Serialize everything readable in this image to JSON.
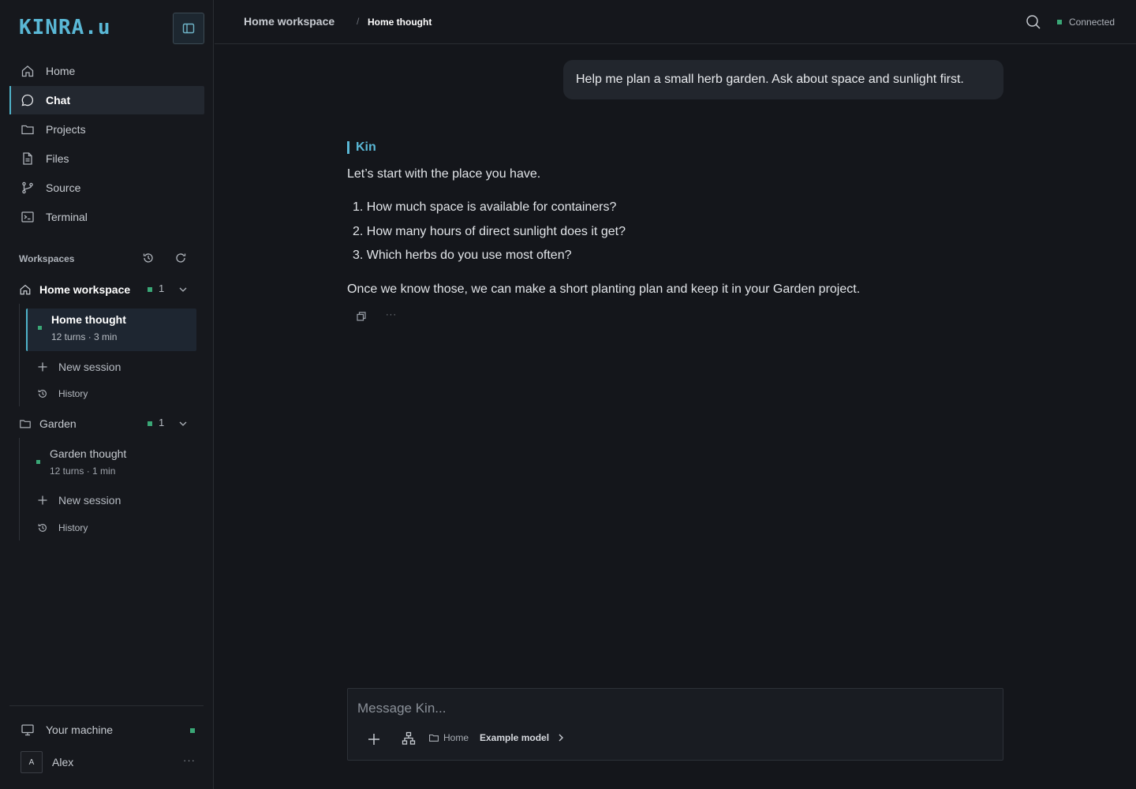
{
  "app": {
    "logo_text": "KINRA.u"
  },
  "nav": {
    "items": [
      {
        "label": "Home",
        "icon": "home-icon"
      },
      {
        "label": "Chat",
        "icon": "chat-icon",
        "active": true
      },
      {
        "label": "Projects",
        "icon": "folder-icon"
      },
      {
        "label": "Files",
        "icon": "file-icon"
      },
      {
        "label": "Source",
        "icon": "git-branch-icon"
      },
      {
        "label": "Terminal",
        "icon": "terminal-icon"
      }
    ]
  },
  "workspaces": {
    "header": "Workspaces",
    "groups": [
      {
        "name": "Home workspace",
        "count": "1",
        "sessions": [
          {
            "title": "Home thought",
            "meta": "12 turns · 3 min",
            "active": true
          }
        ],
        "new_session": "New session",
        "history": "History"
      },
      {
        "name": "Garden",
        "count": "1",
        "sessions": [
          {
            "title": "Garden thought",
            "meta": "12 turns · 1 min",
            "active": false
          }
        ],
        "new_session": "New session",
        "history": "History"
      }
    ]
  },
  "footer": {
    "machine": "Your machine",
    "user_initial": "A",
    "user_name": "Alex",
    "more": "···"
  },
  "topbar": {
    "breadcrumb_workspace": "Home workspace",
    "separator": "/",
    "breadcrumb_current": "Home thought",
    "status": "Connected"
  },
  "chat": {
    "user_message": "Help me plan a small herb garden. Ask about space and sunlight first.",
    "assistant_name": "Kin",
    "intro": "Let’s start with the place you have.",
    "questions": [
      "1. How much space is available for containers?",
      "2. How many hours of direct sunlight does it get?",
      "3. Which herbs do you use most often?"
    ],
    "closing": "Once we know those, we can make a short planting plan and keep it in your Garden project.",
    "more": "···"
  },
  "composer": {
    "placeholder": "Message Kin...",
    "folder": "Home",
    "model": "Example model"
  },
  "colors": {
    "accent": "#4fb3c9",
    "assistant": "#5ab8d6",
    "status_green": "#3aa776",
    "background": "#14161b"
  }
}
